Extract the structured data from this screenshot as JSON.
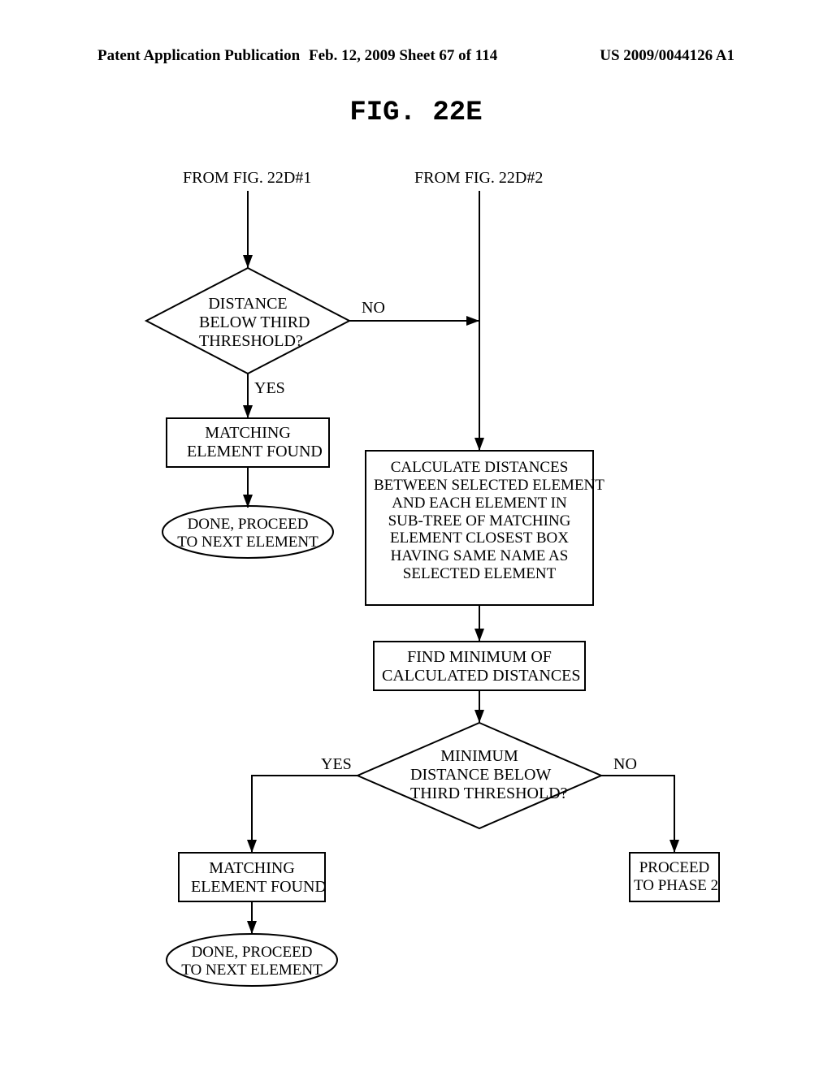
{
  "header": {
    "left": "Patent Application Publication",
    "mid": "Feb. 12, 2009  Sheet 67 of 114",
    "right": "US 2009/0044126 A1"
  },
  "figure_title": "FIG.  22E",
  "labels": {
    "from1": "FROM FIG. 22D#1",
    "from2": "FROM FIG. 22D#2",
    "dec1": "DISTANCE\nBELOW THIRD\nTHRESHOLD?",
    "dec1_no": "NO",
    "dec1_yes": "YES",
    "box_match1": "MATCHING\nELEMENT FOUND",
    "term1": "DONE, PROCEED\nTO NEXT ELEMENT",
    "box_calc": "CALCULATE DISTANCES\nBETWEEN SELECTED ELEMENT\nAND EACH ELEMENT IN\nSUB-TREE OF MATCHING\nELEMENT CLOSEST BOX\nHAVING SAME NAME AS\nSELECTED ELEMENT",
    "box_findmin": "FIND MINIMUM OF\nCALCULATED DISTANCES",
    "dec2": "MINIMUM\nDISTANCE BELOW\nTHIRD THRESHOLD?",
    "dec2_yes": "YES",
    "dec2_no": "NO",
    "box_match2": "MATCHING\nELEMENT FOUND",
    "box_phase2": "PROCEED\nTO PHASE 2",
    "term2": "DONE, PROCEED\nTO NEXT ELEMENT"
  }
}
